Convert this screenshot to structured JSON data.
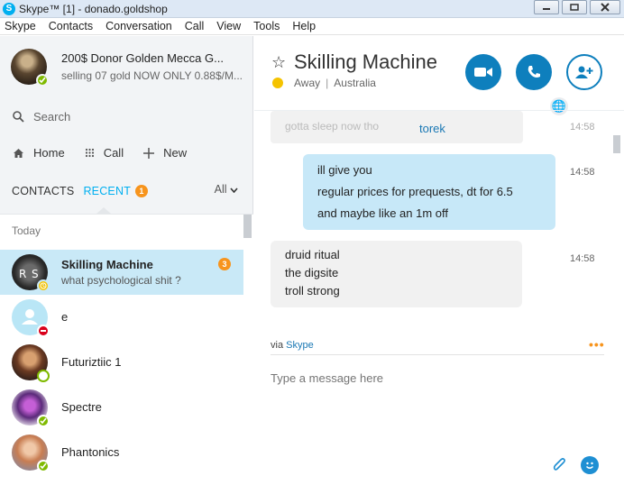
{
  "window": {
    "title": "Skype™ [1] - donado.goldshop",
    "logo": "S"
  },
  "menu": [
    "Skype",
    "Contacts",
    "Conversation",
    "Call",
    "View",
    "Tools",
    "Help"
  ],
  "profile": {
    "name": "200$ Donor Golden Mecca  G...",
    "mood": "selling 07 gold NOW ONLY 0.88$/M..."
  },
  "search": {
    "placeholder": "Search"
  },
  "nav": {
    "home": "Home",
    "call": "Call",
    "new": "New"
  },
  "tabs": {
    "contacts": "CONTACTS",
    "recent": "RECENT",
    "recent_badge": "1",
    "filter": "All"
  },
  "list": {
    "section": "Today",
    "rows": [
      {
        "name": "Skilling Machine",
        "message": "what psychological shit ?",
        "badge": "3",
        "status": "away",
        "status_color": "#f5c300"
      },
      {
        "name": "e",
        "message": "",
        "status": "dnd",
        "status_color": "#d9001b"
      },
      {
        "name": "Futuriztiic 1",
        "message": "",
        "status": "offline",
        "status_color": "#ffffff"
      },
      {
        "name": "Spectre",
        "message": "",
        "status": "online",
        "status_color": "#7fba00"
      },
      {
        "name": "Phantonics",
        "message": "",
        "status": "online",
        "status_color": "#7fba00"
      }
    ]
  },
  "conversation": {
    "contact": "Skilling Machine",
    "status": "Away",
    "location": "Australia",
    "faded_text": "gotta sleep now tho",
    "torek": "torek",
    "faded_time": "14:58",
    "messages": [
      {
        "direction": "out",
        "time": "14:58",
        "lines": [
          "ill give you",
          "regular prices for prequests, dt for 6.5",
          "and maybe like an 1m off"
        ]
      },
      {
        "direction": "in",
        "time": "14:58",
        "lines": [
          "druid ritual",
          "the digsite",
          "troll strong"
        ]
      }
    ],
    "via": "via",
    "via_link": "Skype",
    "input_placeholder": "Type a message here"
  },
  "colors": {
    "accent": "#00aff0",
    "button": "#0e7fbd",
    "selected": "#c9e9f7",
    "badge": "#f7941d"
  }
}
